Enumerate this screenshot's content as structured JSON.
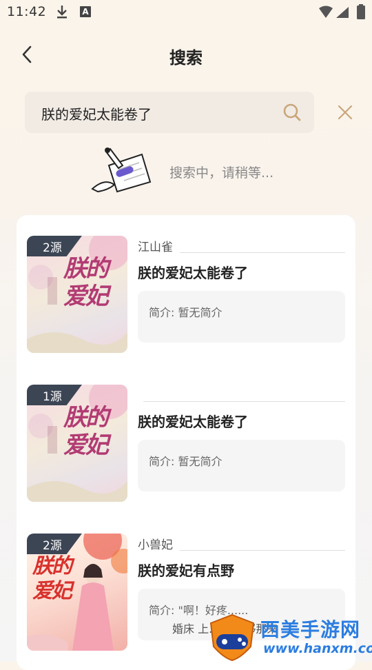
{
  "status": {
    "time": "11:42",
    "notif_a": "A"
  },
  "header": {
    "title": "搜索"
  },
  "search": {
    "query": "朕的爱妃太能卷了"
  },
  "searching": {
    "text": "搜索中，请稍等..."
  },
  "books": [
    {
      "badge": "2源",
      "author": "江山雀",
      "title": "朕的爱妃太能卷了",
      "intro": "简介: 暂无简介",
      "cover_title": "朕的爱妃"
    },
    {
      "badge": "1源",
      "author": "",
      "title": "朕的爱妃太能卷了",
      "intro": "简介: 暂无简介",
      "cover_title": "朕的爱妃"
    },
    {
      "badge": "2源",
      "author": "小兽妃",
      "title": "朕的爱妃有点野",
      "intro": "简介: \"啊！好疼......",
      "cover_title": "朕的爱妃"
    }
  ],
  "watermark": {
    "name": "西美手游网",
    "url": "www.hanxm.com",
    "overlay_text": "婚床 上...  只能够那来"
  },
  "colors": {
    "accent": "#c9a67a",
    "badge_bg": "#3c4554",
    "watermark": "#2b7de0"
  }
}
